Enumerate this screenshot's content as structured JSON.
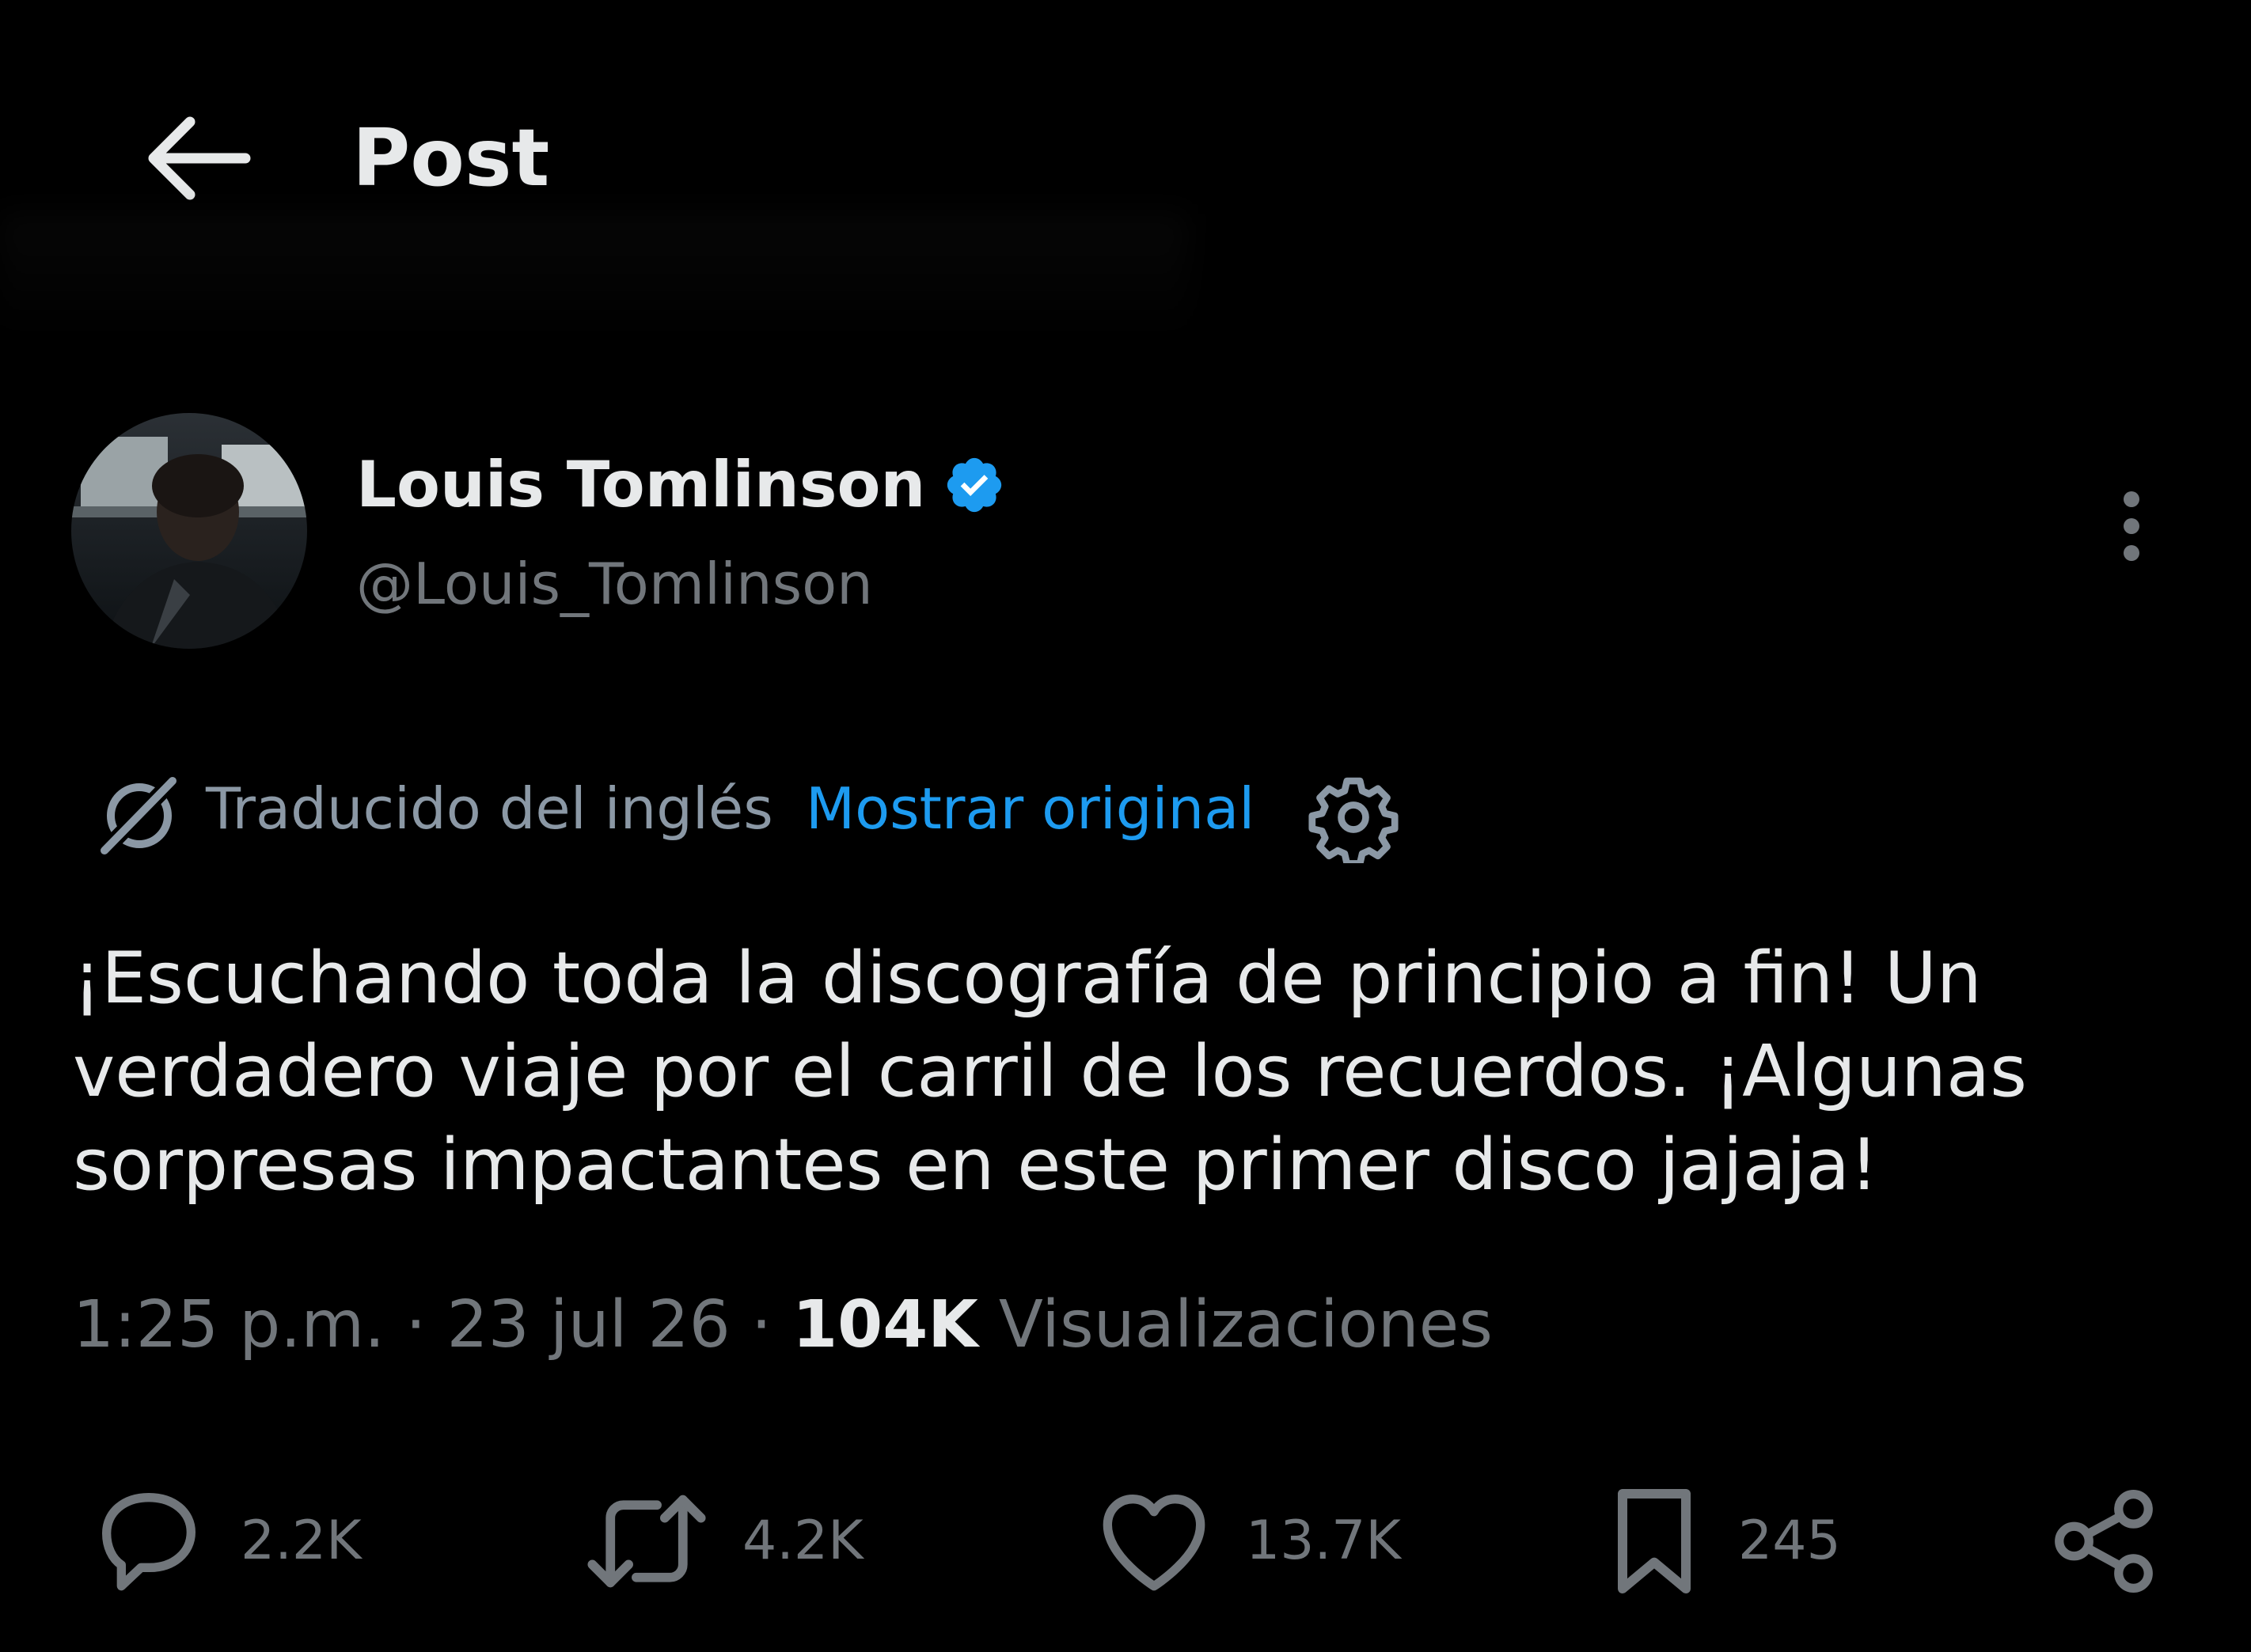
{
  "header": {
    "title": "Post",
    "back_icon": "arrow-left-icon"
  },
  "author": {
    "display_name": "Louis Tomlinson",
    "handle": "@Louis_Tomlinson",
    "verified_icon": "verified-badge-icon",
    "verified_color": "#1d9bf0",
    "more_icon": "more-vertical-icon"
  },
  "translation": {
    "label": "Traducido del inglés",
    "show_original": "Mostrar original",
    "translate_icon": "translate-icon",
    "settings_icon": "gear-icon"
  },
  "post": {
    "text": "¡Escuchando toda la discografía de principio a fin! Un verdadero viaje por el carril de los recuerdos. ¡Algunas sorpresas impactantes en este primer disco jajaja!"
  },
  "meta": {
    "time": "1:25 p.m.",
    "separator": "·",
    "date": "23 jul 26",
    "views_count": "104K",
    "views_label": "Visualizaciones"
  },
  "actions": {
    "replies": "2.2K",
    "reposts": "4.2K",
    "likes": "13.7K",
    "bookmarks": "245"
  },
  "colors": {
    "background": "#000000",
    "text_primary": "#e7e9ea",
    "text_secondary": "#71767b",
    "link": "#1d9bf0"
  }
}
